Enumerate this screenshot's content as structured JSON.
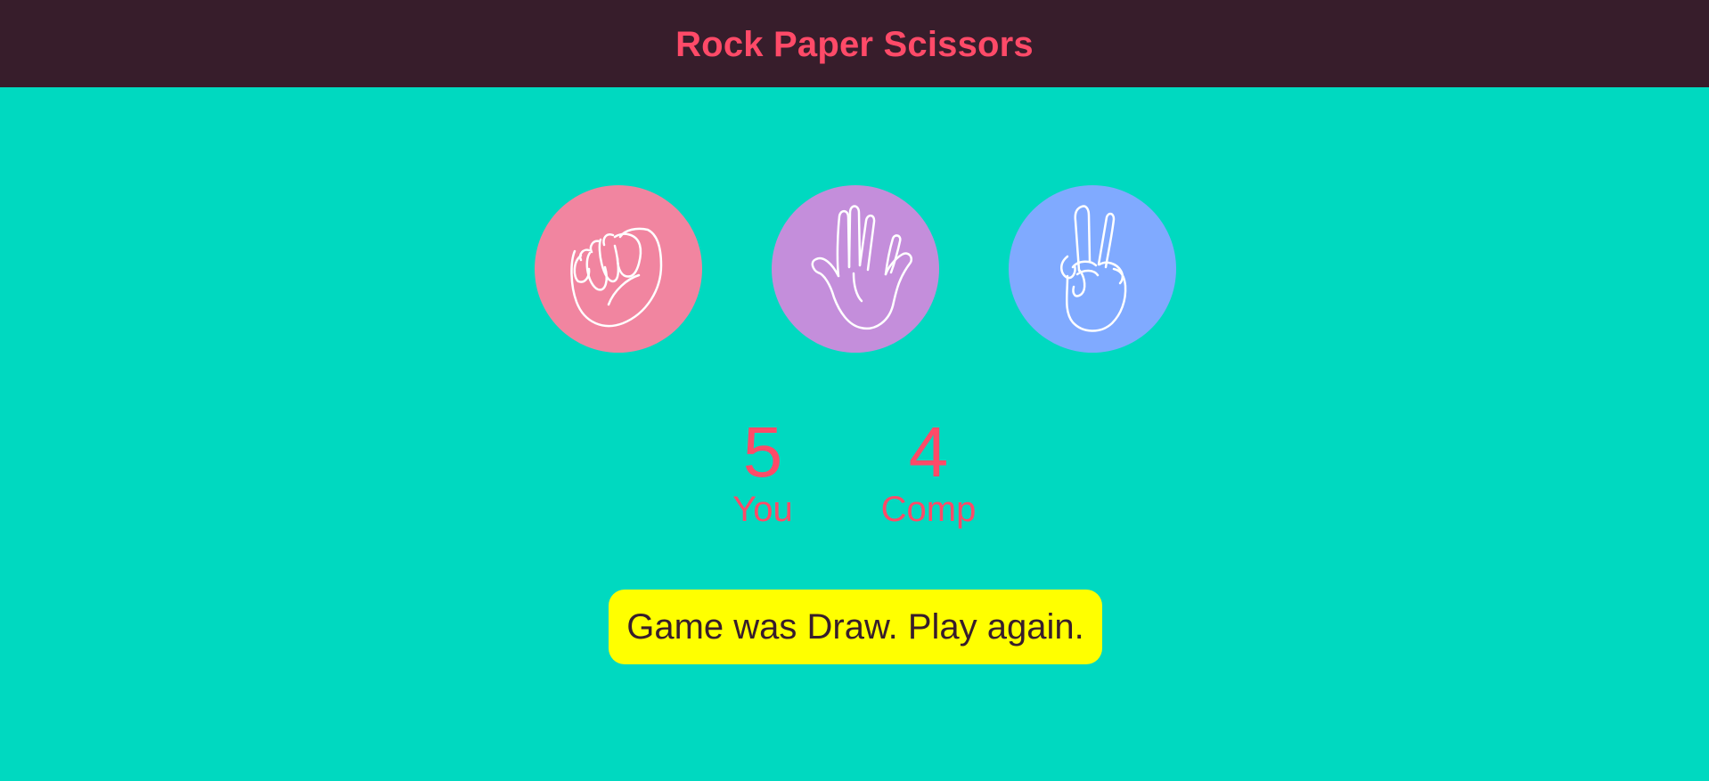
{
  "header": {
    "title": "Rock Paper Scissors"
  },
  "choices": [
    {
      "id": "rock",
      "icon": "fist-icon",
      "color": "#f185a0"
    },
    {
      "id": "paper",
      "icon": "open-hand-icon",
      "color": "#c48edb"
    },
    {
      "id": "scissors",
      "icon": "peace-hand-icon",
      "color": "#80aaff"
    }
  ],
  "scoreboard": {
    "user_score": "5",
    "user_label": "You",
    "comp_score": "4",
    "comp_label": "Comp"
  },
  "result": {
    "message": "Game was Draw. Play again."
  },
  "colors": {
    "background": "#00d9c0",
    "header_background": "#371d2b",
    "accent": "#ff4a68",
    "result_background": "#ffff00",
    "result_text": "#371d2b"
  }
}
